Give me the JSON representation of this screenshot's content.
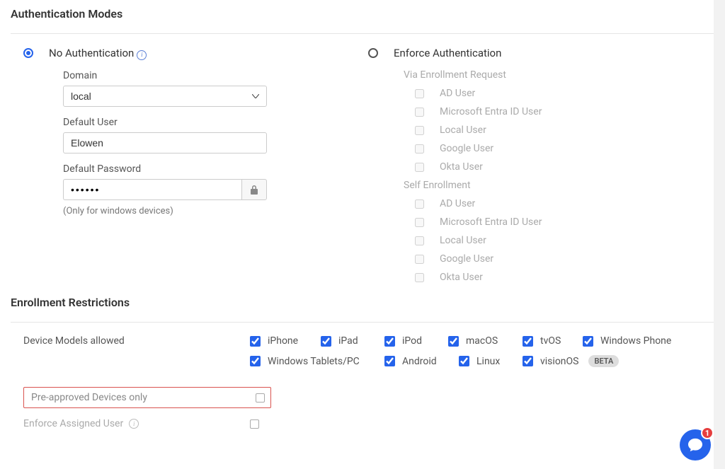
{
  "auth": {
    "title": "Authentication Modes",
    "no_auth_label": "No Authentication",
    "enforce_label": "Enforce Authentication",
    "domain_label": "Domain",
    "domain_value": "local",
    "default_user_label": "Default User",
    "default_user_value": "Elowen",
    "default_pw_label": "Default Password",
    "default_pw_value": "••••••",
    "pw_helper": "(Only for windows devices)",
    "via_enrollment": "Via Enrollment Request",
    "self_enrollment": "Self Enrollment",
    "users": {
      "ad": "AD User",
      "entra": "Microsoft Entra ID User",
      "local": "Local User",
      "google": "Google User",
      "okta": "Okta User"
    }
  },
  "restrict": {
    "title": "Enrollment Restrictions",
    "models_label": "Device Models allowed",
    "preapprove_label": "Pre-approved Devices only",
    "enforce_assigned_label": "Enforce Assigned User",
    "beta": "BETA",
    "models": {
      "iphone": "iPhone",
      "ipad": "iPad",
      "ipod": "iPod",
      "macos": "macOS",
      "tvos": "tvOS",
      "winphone": "Windows Phone",
      "wintab": "Windows Tablets/PC",
      "android": "Android",
      "linux": "Linux",
      "visionos": "visionOS"
    }
  },
  "chat": {
    "badge": "1"
  }
}
